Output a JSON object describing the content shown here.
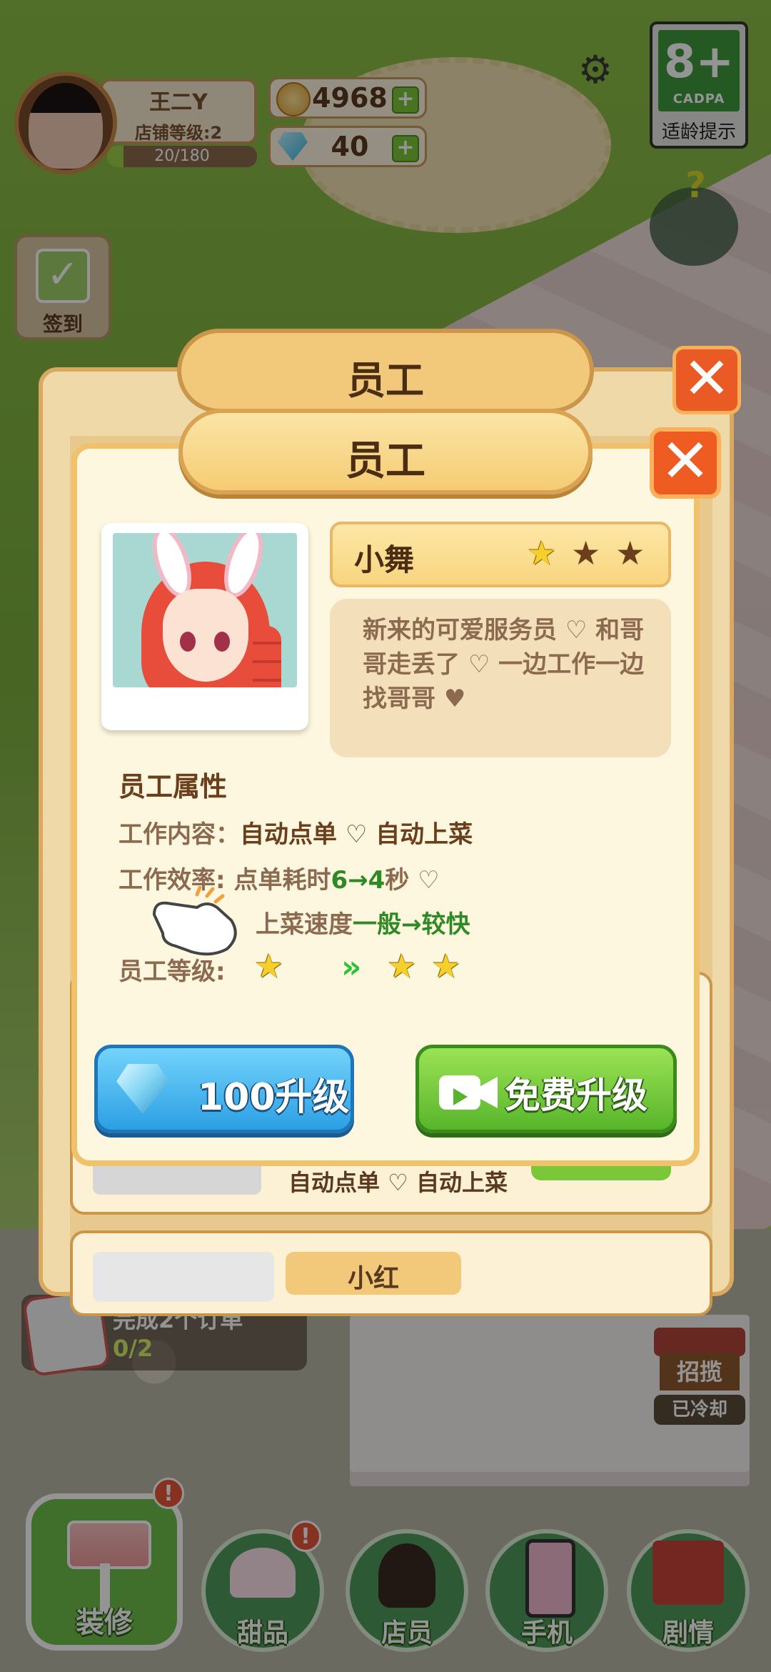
{
  "hud": {
    "player_name": "王二Y",
    "shop_level_label": "店铺等级:2",
    "xp_text": "20/180",
    "xp_fraction": 0.111,
    "coins": "4968",
    "gems": "40",
    "age_rating": "8+",
    "age_org": "CADPA",
    "age_label": "适龄提示",
    "signin_label": "签到"
  },
  "back_modal": {
    "title": "员工",
    "row_text": "自动点单 ♡ 自动上菜",
    "next_name": "小红"
  },
  "modal": {
    "title": "员工",
    "employee_name": "小舞",
    "stars": [
      true,
      false,
      false
    ],
    "description": "新来的可爱服务员 ♡ 和哥哥走丢了 ♡ 一边工作一边找哥哥 ♥",
    "attributes_title": "员工属性",
    "work_content_label": "工作内容：",
    "work_content_value": "自动点单 ♡ 自动上菜",
    "efficiency_label": "工作效率:",
    "order_time_prefix": "点单耗时",
    "order_time_change": "6→4",
    "order_time_suffix": "秒 ♡",
    "serve_speed_prefix": "上菜速度",
    "serve_speed_change": "一般→较快",
    "grade_label": "员工等级:",
    "grade_current_stars": 1,
    "grade_next_stars": 2,
    "upgrade_gem_label": "100升级",
    "upgrade_free_label": "免费升级"
  },
  "task": {
    "title": "完成2个订单",
    "progress": "0/2"
  },
  "recruit": {
    "sign": "招揽",
    "status": "已冷却"
  },
  "nav": {
    "renovate": "装修",
    "dessert": "甜品",
    "staff": "店员",
    "phone": "手机",
    "story": "剧情",
    "badge": "!"
  },
  "colors": {
    "panel_border": "#f0c26b",
    "close_button": "#ef5c22",
    "gem_button": "#2c9fe4",
    "free_button": "#58b52b",
    "highlight_green": "#2f8a25"
  }
}
